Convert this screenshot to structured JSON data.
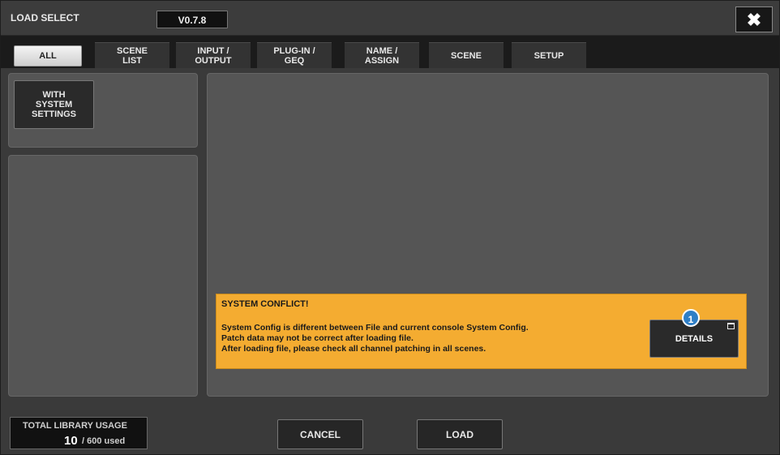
{
  "window": {
    "title": "LOAD SELECT",
    "version": "V0.7.8",
    "close_glyph": "✖"
  },
  "tabs": [
    {
      "label": "ALL",
      "active": true
    },
    {
      "label": "SCENE\nLIST"
    },
    {
      "label": "INPUT /\nOUTPUT"
    },
    {
      "label": "PLUG-IN /\nGEQ"
    },
    {
      "label": "NAME /\nASSIGN"
    },
    {
      "label": "SCENE"
    },
    {
      "label": "SETUP"
    }
  ],
  "left_panel": {
    "with_system_settings_label": "WITH\nSYSTEM\nSETTINGS"
  },
  "conflict": {
    "title": "SYSTEM CONFLICT!",
    "lines": [
      "System Config is different between File and current console System Config.",
      "Patch data may not be correct after loading file.",
      "After loading file, please check all channel patching in all scenes."
    ],
    "details_label": "DETAILS",
    "callout_number": "1"
  },
  "footer": {
    "usage_label": "TOTAL LIBRARY USAGE",
    "usage_value": "10",
    "usage_total": "/ 600 used",
    "cancel_label": "CANCEL",
    "load_label": "LOAD"
  },
  "colors": {
    "conflict_bg": "#f4ac31",
    "callout": "#2f7fc6"
  }
}
